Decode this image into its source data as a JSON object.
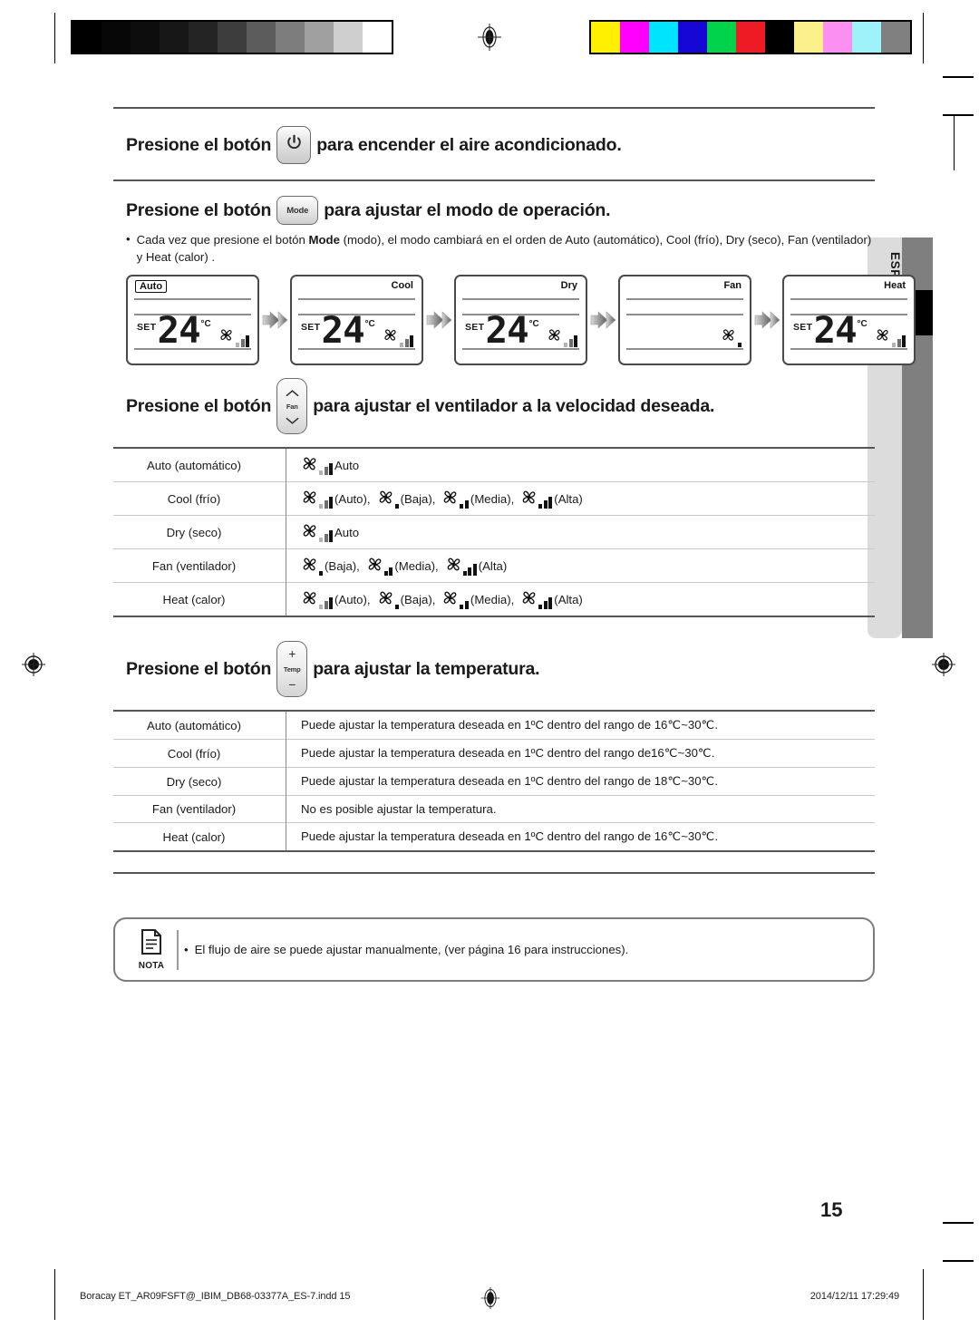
{
  "calibration": {
    "gray_ramp": [
      "#000000",
      "#060606",
      "#0d0d0d",
      "#171717",
      "#242424",
      "#3d3d3d",
      "#5c5c5c",
      "#7d7d7d",
      "#9f9f9f",
      "#cfcfcf",
      "#ffffff"
    ],
    "color_bars": [
      "#ffef00",
      "#ff00ff",
      "#00e5ff",
      "#1707d6",
      "#00d24a",
      "#ee1b24",
      "#000000",
      "#fbf08a",
      "#fb8ff2",
      "#9ef3f8",
      "#808080"
    ]
  },
  "sidebar": {
    "language_tab": "ESPAÑOL"
  },
  "sections": {
    "power": {
      "lead": "Presione el botón",
      "button_icon": "power-icon",
      "trail": "para encender el aire acondicionado."
    },
    "mode": {
      "lead": "Presione el botón",
      "button_label": "Mode",
      "trail": "para ajustar el modo de operación.",
      "bullet_prefix": "Cada vez que presione el botón",
      "bullet_bold": "Mode",
      "bullet_rest": "(modo), el modo cambiará en el orden de Auto (automático), Cool (frío), Dry (seco), Fan (ventilador) y Heat (calor) ."
    },
    "fan": {
      "lead": "Presione el botón",
      "button_label": "Fan",
      "trail": "para ajustar el ventilador a la velocidad deseada."
    },
    "temp": {
      "lead": "Presione el botón",
      "button_label": "Temp",
      "button_plus": "+",
      "button_minus": "−",
      "trail": "para ajustar la temperatura."
    }
  },
  "lcd_panels": [
    {
      "mode_label": "Auto",
      "boxed": true,
      "align": "left",
      "show_set": true,
      "set_text": "SET",
      "temperature": "24",
      "unit": "°C",
      "fan_bars": "auto"
    },
    {
      "mode_label": "Cool",
      "boxed": false,
      "align": "right",
      "show_set": true,
      "set_text": "SET",
      "temperature": "24",
      "unit": "°C",
      "fan_bars": "auto"
    },
    {
      "mode_label": "Dry",
      "boxed": false,
      "align": "right",
      "show_set": true,
      "set_text": "SET",
      "temperature": "24",
      "unit": "°C",
      "fan_bars": "auto"
    },
    {
      "mode_label": "Fan",
      "boxed": false,
      "align": "right",
      "show_set": false,
      "set_text": "",
      "temperature": "",
      "unit": "",
      "fan_bars": "low"
    },
    {
      "mode_label": "Heat",
      "boxed": false,
      "align": "right",
      "show_set": true,
      "set_text": "SET",
      "temperature": "24",
      "unit": "°C",
      "fan_bars": "auto"
    }
  ],
  "fan_table": {
    "rows": [
      {
        "mode": "Auto (automático)",
        "speeds": [
          {
            "bars": "auto",
            "label": "Auto"
          }
        ]
      },
      {
        "mode": "Cool (frío)",
        "speeds": [
          {
            "bars": "auto",
            "label": "(Auto),"
          },
          {
            "bars": "low",
            "label": "(Baja),"
          },
          {
            "bars": "medium",
            "label": "(Media),"
          },
          {
            "bars": "high",
            "label": "(Alta)"
          }
        ]
      },
      {
        "mode": "Dry (seco)",
        "speeds": [
          {
            "bars": "auto",
            "label": "Auto"
          }
        ]
      },
      {
        "mode": "Fan (ventilador)",
        "speeds": [
          {
            "bars": "low",
            "label": "(Baja),"
          },
          {
            "bars": "medium",
            "label": "(Media),"
          },
          {
            "bars": "high",
            "label": "(Alta)"
          }
        ]
      },
      {
        "mode": "Heat (calor)",
        "speeds": [
          {
            "bars": "auto",
            "label": "(Auto),"
          },
          {
            "bars": "low",
            "label": "(Baja),"
          },
          {
            "bars": "medium",
            "label": "(Media),"
          },
          {
            "bars": "high",
            "label": "(Alta)"
          }
        ]
      }
    ]
  },
  "temp_table": {
    "rows": [
      {
        "mode": "Auto (automático)",
        "text": "Puede ajustar la temperatura deseada en 1ºC dentro del rango de 16℃~30℃."
      },
      {
        "mode": "Cool (frío)",
        "text": "Puede ajustar la temperatura deseada en 1ºC dentro del rango de16℃~30℃."
      },
      {
        "mode": "Dry (seco)",
        "text": "Puede ajustar la temperatura deseada en 1ºC dentro del rango de 18℃~30℃."
      },
      {
        "mode": "Fan (ventilador)",
        "text": "No es posible ajustar la temperatura."
      },
      {
        "mode": "Heat (calor)",
        "text": "Puede ajustar la temperatura deseada en 1ºC dentro del rango de 16℃~30℃."
      }
    ]
  },
  "note": {
    "caption": "NOTA",
    "bullet": "•",
    "text": "El flujo de aire se puede ajustar manualmente, (ver página 16 para instrucciones)."
  },
  "page_number": "15",
  "footer": {
    "filename": "Boracay ET_AR09FSFT@_IBIM_DB68-03377A_ES-7.indd   15",
    "timestamp": "2014/12/11   17:29:49"
  }
}
